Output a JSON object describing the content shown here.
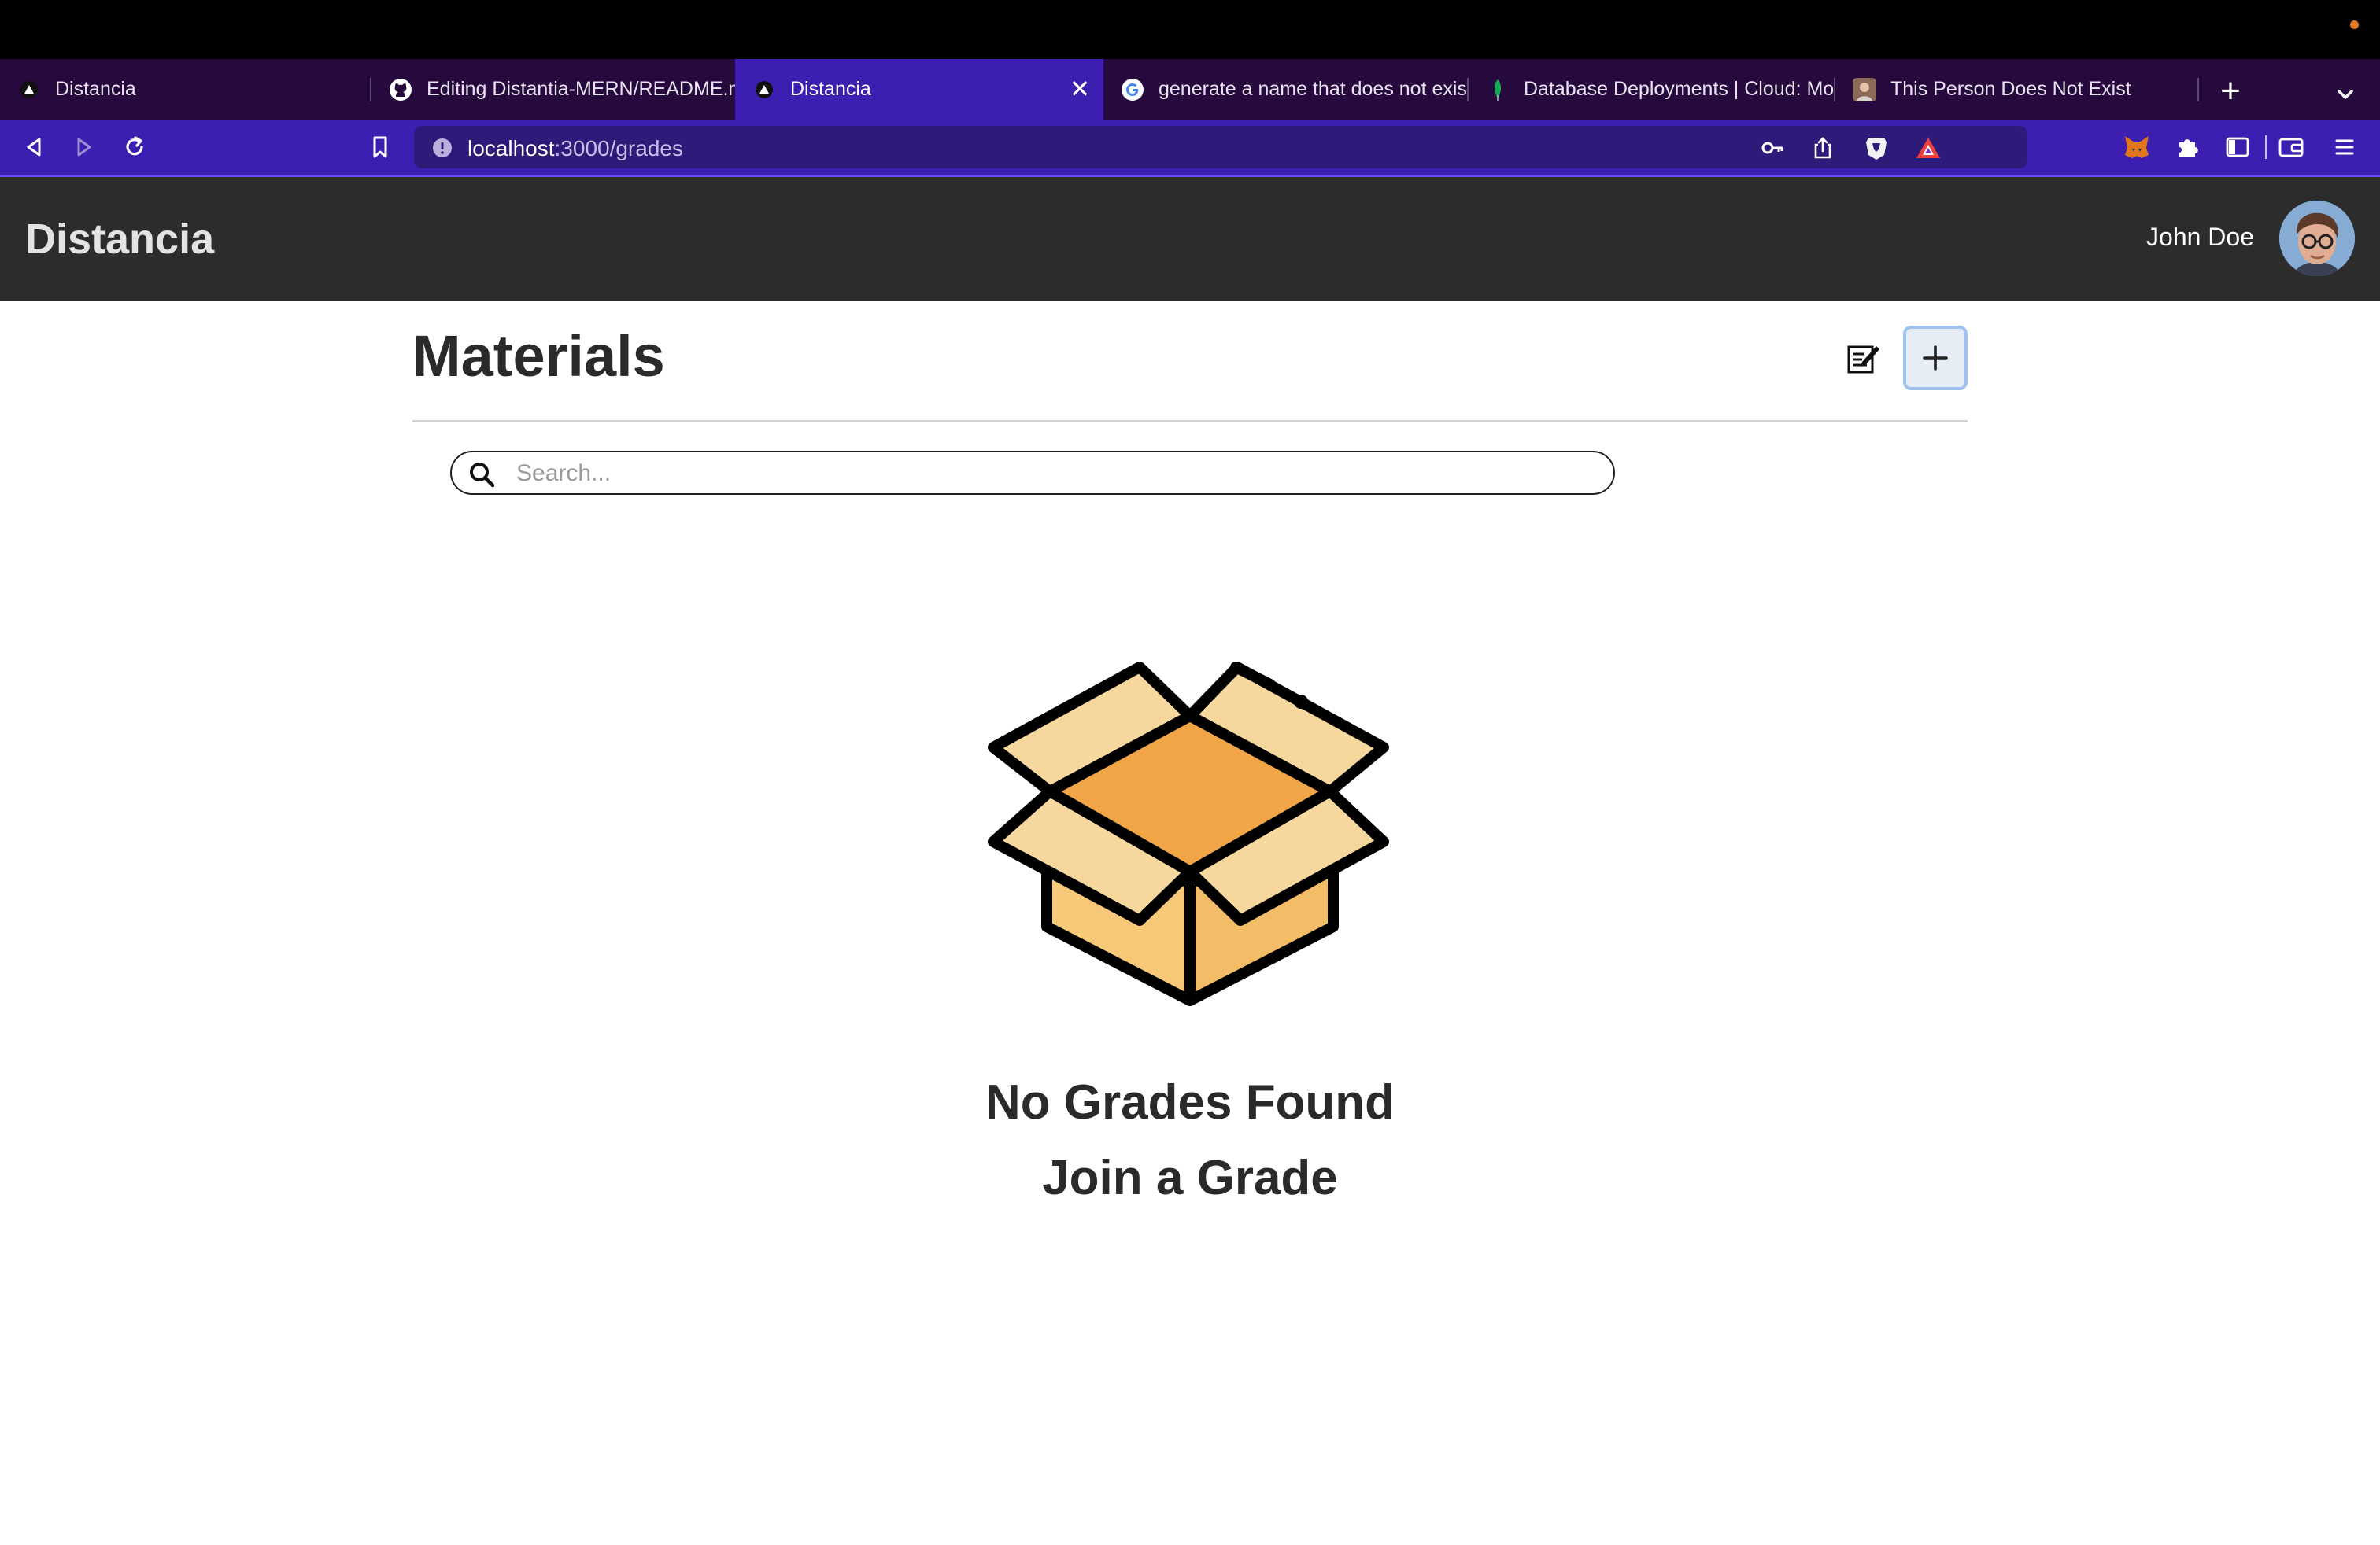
{
  "browser": {
    "tabs": [
      {
        "title": "Distancia",
        "favicon": "triangle-icon",
        "active": false
      },
      {
        "title": "Editing Distantia-MERN/README.md",
        "favicon": "github-icon",
        "active": false
      },
      {
        "title": "Distancia",
        "favicon": "triangle-icon",
        "active": true
      },
      {
        "title": "generate a name that does not exist",
        "favicon": "google-icon",
        "active": false
      },
      {
        "title": "Database Deployments | Cloud: MongoDB",
        "favicon": "mongodb-leaf-icon",
        "active": false
      },
      {
        "title": "This Person Does Not Exist",
        "favicon": "person-photo-icon",
        "active": false
      }
    ],
    "close_glyph": "✕",
    "new_tab_glyph": "+",
    "url_host": "localhost",
    "url_path": ":3000/grades",
    "colors": {
      "tabstrip": "#26093d",
      "active_tab": "#3c1fb0",
      "toolbar": "#3c1fb0"
    }
  },
  "app": {
    "brand": "Distancia",
    "user_name": "John Doe",
    "header_color": "#2c2c2c"
  },
  "page": {
    "title": "Materials",
    "add_glyph": "+",
    "search_placeholder": "Search...",
    "empty_title": "No Grades Found",
    "empty_subtitle": "Join a Grade",
    "illustration": "open-box-icon"
  }
}
